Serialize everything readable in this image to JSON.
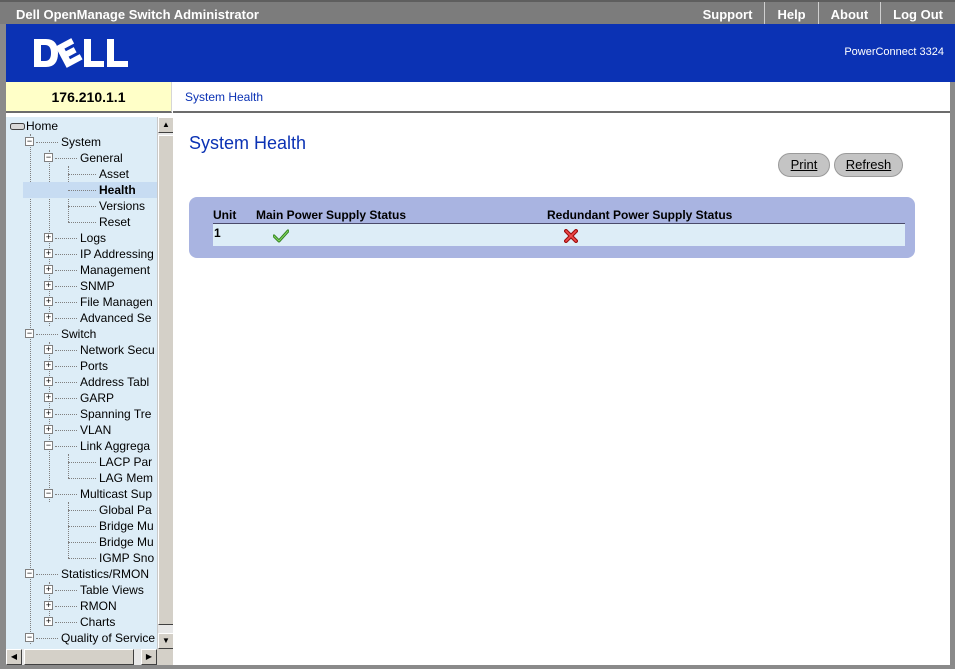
{
  "window": {
    "title": "Dell OpenManage Switch Administrator"
  },
  "topnav": {
    "support": "Support",
    "help": "Help",
    "about": "About",
    "logout": "Log Out"
  },
  "banner": {
    "logo": "DELL",
    "model": "PowerConnect 3324"
  },
  "ip_address": "176.210.1.1",
  "breadcrumb": "System Health",
  "tree": {
    "home": "Home",
    "system": "System",
    "general": "General",
    "asset": "Asset",
    "health": "Health",
    "versions": "Versions",
    "reset": "Reset",
    "logs": "Logs",
    "ip_addressing": "IP Addressing",
    "management": "Management",
    "snmp": "SNMP",
    "file_management": "File Managen",
    "advanced_settings": "Advanced Se",
    "switch": "Switch",
    "network_security": "Network Secu",
    "ports": "Ports",
    "address_tables": "Address Tabl",
    "garp": "GARP",
    "spanning_tree": "Spanning Tre",
    "vlan": "VLAN",
    "link_aggregation": "Link Aggrega",
    "lacp_parameters": "LACP Par",
    "lag_membership": "LAG Mem",
    "multicast_support": "Multicast Sup",
    "global_parameters": "Global Pa",
    "bridge_multicast_1": "Bridge Mu",
    "bridge_multicast_2": "Bridge Mu",
    "igmp_snooping": "IGMP Sno",
    "statistics_rmon": "Statistics/RMON",
    "table_views": "Table Views",
    "rmon": "RMON",
    "charts": "Charts",
    "quality_of_service": "Quality of Service"
  },
  "page": {
    "title": "System Health",
    "print_label": "Print",
    "refresh_label": "Refresh"
  },
  "table": {
    "headers": {
      "unit": "Unit",
      "main": "Main Power Supply Status",
      "redundant": "Redundant Power Supply Status"
    },
    "rows": [
      {
        "unit": "1",
        "main_status": "ok",
        "redundant_status": "failed"
      }
    ]
  },
  "colors": {
    "banner_blue": "#0b32b4",
    "tree_bg": "#ddedf7",
    "table_frame": "#a9b4e1"
  }
}
